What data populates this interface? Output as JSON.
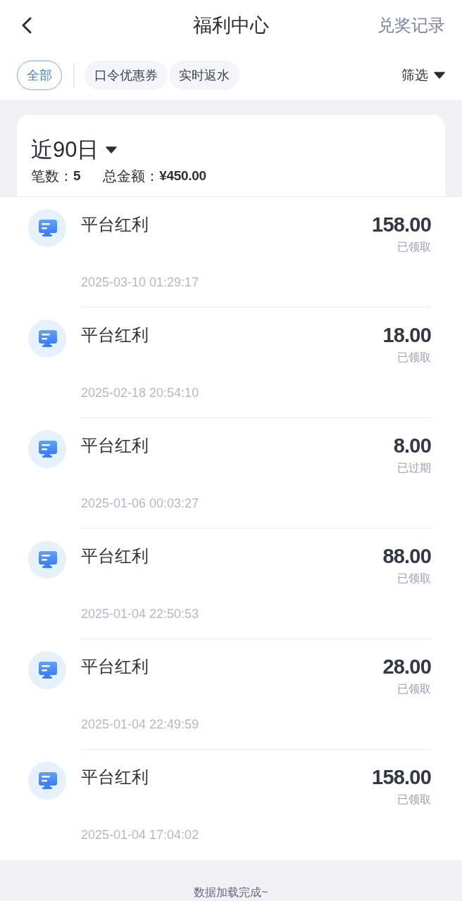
{
  "header": {
    "title": "福利中心",
    "action": "兑奖记录"
  },
  "filters": {
    "chips": [
      {
        "label": "全部",
        "selected": true
      },
      {
        "label": "口令优惠券",
        "selected": false
      },
      {
        "label": "实时返水",
        "selected": false
      }
    ],
    "filter_button": "筛选"
  },
  "summary": {
    "period": "近90日",
    "count_label": "笔数：",
    "count": "5",
    "total_label": "总金额：",
    "total": "¥450.00"
  },
  "records": [
    {
      "title": "平台红利",
      "amount": "158.00",
      "status": "已领取",
      "time": "2025-03-10 01:29:17"
    },
    {
      "title": "平台红利",
      "amount": "18.00",
      "status": "已领取",
      "time": "2025-02-18 20:54:10"
    },
    {
      "title": "平台红利",
      "amount": "8.00",
      "status": "已过期",
      "time": "2025-01-06 00:03:27"
    },
    {
      "title": "平台红利",
      "amount": "88.00",
      "status": "已领取",
      "time": "2025-01-04 22:50:53"
    },
    {
      "title": "平台红利",
      "amount": "28.00",
      "status": "已领取",
      "time": "2025-01-04 22:49:59"
    },
    {
      "title": "平台红利",
      "amount": "158.00",
      "status": "已领取",
      "time": "2025-01-04 17:04:02"
    }
  ],
  "footer": "数据加载完成~"
}
